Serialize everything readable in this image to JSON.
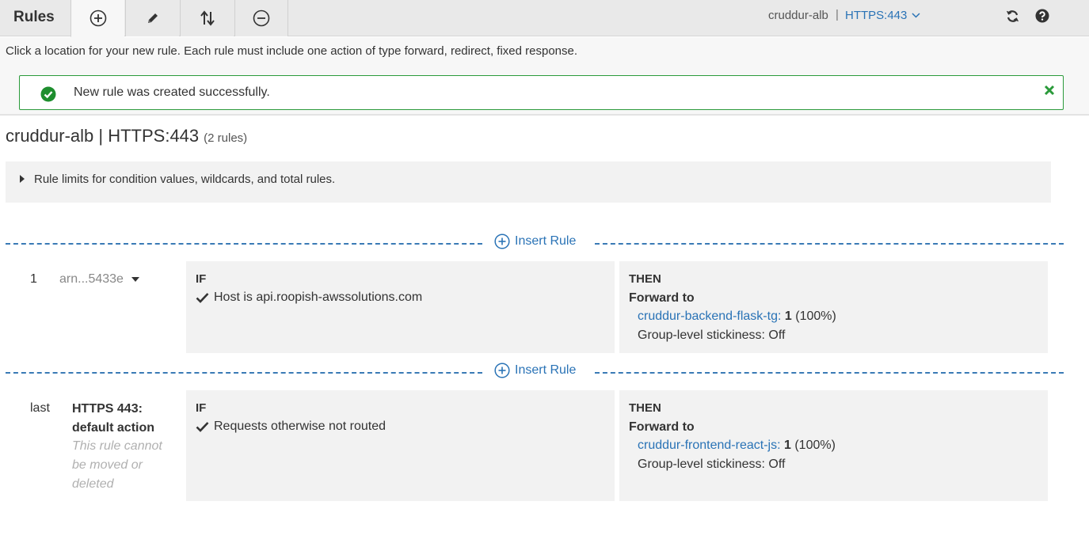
{
  "toolbar": {
    "title": "Rules",
    "buttons": [
      {
        "icon": "plus-circle-icon",
        "label": "Add rules"
      },
      {
        "icon": "pencil-icon",
        "label": "Edit rules"
      },
      {
        "icon": "reorder-icon",
        "label": "Reorder rules"
      },
      {
        "icon": "minus-circle-icon",
        "label": "Delete rules"
      }
    ],
    "load_balancer": "cruddur-alb",
    "separator": "|",
    "listener": "HTTPS:443",
    "refresh_icon": "refresh-icon",
    "help_icon": "help-icon"
  },
  "info": {
    "instruction": "Click a location for your new rule. Each rule must include one action of type forward, redirect, fixed response."
  },
  "alert": {
    "message": "New rule was created successfully.",
    "color": "#2a9a3a"
  },
  "heading": {
    "title": "cruddur-alb | HTTPS:443",
    "count": "(2 rules)"
  },
  "limits": {
    "text": "Rule limits for condition values, wildcards, and total rules."
  },
  "insert_rule_label": "Insert Rule",
  "rules": [
    {
      "number": "1",
      "arn": "arn...5433e",
      "if_label": "IF",
      "condition": "Host is api.roopish-awssolutions.com",
      "then_label": "THEN",
      "action": "Forward to",
      "target_group": "cruddur-backend-flask-tg",
      "weight_sep": ":",
      "weight": "1",
      "percent": "(100%)",
      "stickiness": "Group-level stickiness: Off"
    },
    {
      "number": "last",
      "default_title": "HTTPS 443: default action",
      "note": "This rule cannot be moved or deleted",
      "if_label": "IF",
      "condition": "Requests otherwise not routed",
      "then_label": "THEN",
      "action": "Forward to",
      "target_group": "cruddur-frontend-react-js",
      "weight_sep": ":",
      "weight": "1",
      "percent": "(100%)",
      "stickiness": "Group-level stickiness: Off"
    }
  ],
  "colors": {
    "link": "#2a73b6",
    "panel": "#f2f2f2",
    "success": "#2a9a3a"
  }
}
